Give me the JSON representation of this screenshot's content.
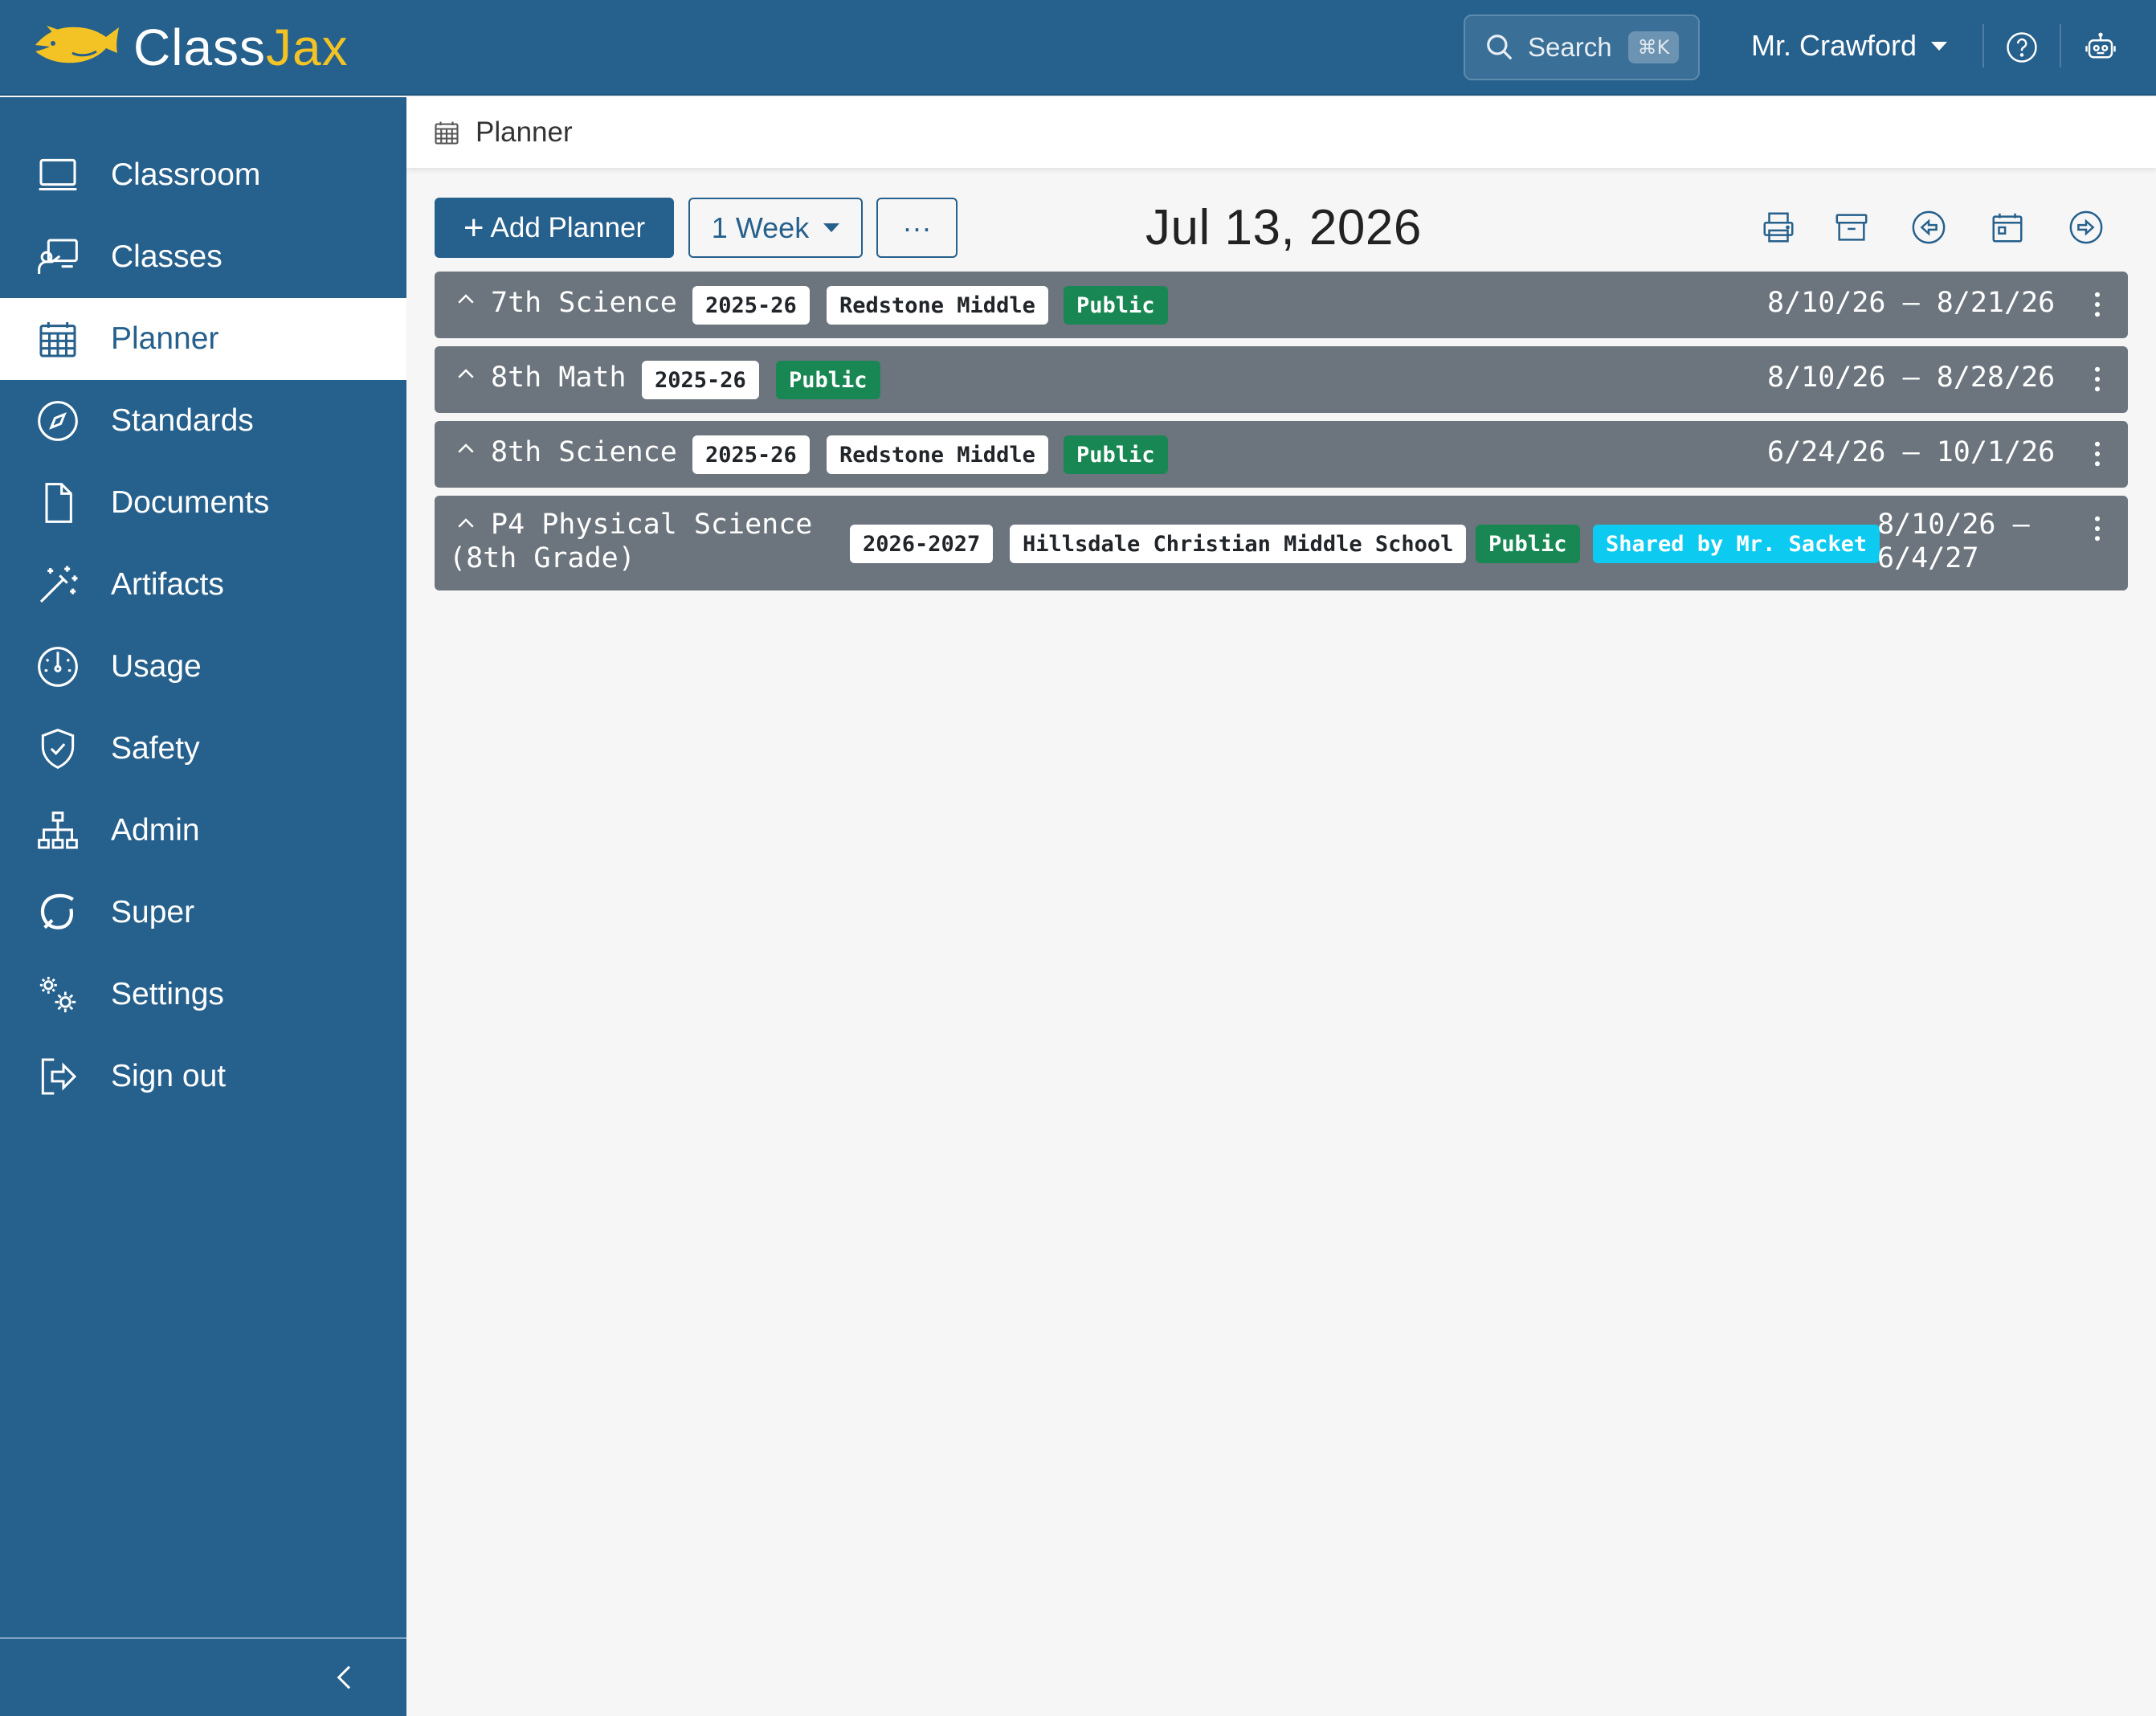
{
  "app": {
    "logo_class": "Class",
    "logo_jax": "Jax"
  },
  "header": {
    "search_label": "Search",
    "search_shortcut": "⌘K",
    "user_name": "Mr. Crawford"
  },
  "sidebar": {
    "items": [
      {
        "label": "Classroom",
        "icon": "monitor-icon"
      },
      {
        "label": "Classes",
        "icon": "teacher-board-icon"
      },
      {
        "label": "Planner",
        "icon": "calendar-icon",
        "active": true
      },
      {
        "label": "Standards",
        "icon": "compass-icon"
      },
      {
        "label": "Documents",
        "icon": "document-icon"
      },
      {
        "label": "Artifacts",
        "icon": "magic-wand-icon"
      },
      {
        "label": "Usage",
        "icon": "speedometer-icon"
      },
      {
        "label": "Safety",
        "icon": "shield-check-icon"
      },
      {
        "label": "Admin",
        "icon": "org-chart-icon"
      },
      {
        "label": "Super",
        "icon": "loop-icon"
      },
      {
        "label": "Settings",
        "icon": "gears-icon"
      },
      {
        "label": "Sign out",
        "icon": "sign-out-icon"
      }
    ]
  },
  "breadcrumb": {
    "label": "Planner"
  },
  "toolbar": {
    "add_label": "Add Planner",
    "range_label": "1 Week",
    "more_label": "···",
    "date_title": "Jul 13, 2026"
  },
  "planners": [
    {
      "title": "7th Science",
      "year": "2025-26",
      "school": "Redstone Middle",
      "visibility": "Public",
      "dates": "8/10/26 – 8/21/26"
    },
    {
      "title": "8th Math",
      "year": "2025-26",
      "visibility": "Public",
      "dates": "8/10/26 – 8/28/26"
    },
    {
      "title": "8th Science",
      "year": "2025-26",
      "school": "Redstone Middle",
      "visibility": "Public",
      "dates": "6/24/26 – 10/1/26"
    },
    {
      "title": "P4 Physical Science\n(8th Grade)",
      "year": "2026-2027",
      "school": "Hillsdale Christian Middle School",
      "visibility": "Public",
      "shared": "Shared by Mr. Sacket",
      "dates": "8/10/26 –\n6/4/27"
    }
  ],
  "colors": {
    "brand": "#26608c",
    "logo_accent": "#f3c325",
    "row_bg": "#6c757d",
    "badge_green": "#198754",
    "badge_cyan": "#0dcaf0"
  }
}
